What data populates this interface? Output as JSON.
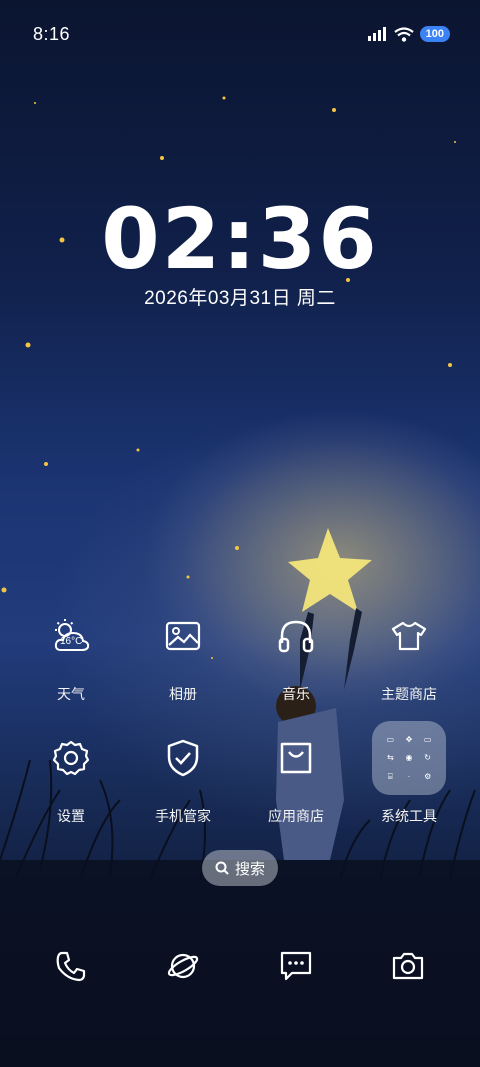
{
  "status_bar": {
    "time": "8:16",
    "battery": "100"
  },
  "clock": {
    "time": "02:36",
    "date": "2026年03月31日  周二"
  },
  "apps": [
    {
      "label": "天气",
      "icon": "weather-icon",
      "temp": "16°C"
    },
    {
      "label": "相册",
      "icon": "gallery-icon"
    },
    {
      "label": "音乐",
      "icon": "headphones-icon"
    },
    {
      "label": "主题商店",
      "icon": "tshirt-icon"
    },
    {
      "label": "设置",
      "icon": "gear-icon"
    },
    {
      "label": "手机管家",
      "icon": "shield-check-icon"
    },
    {
      "label": "应用商店",
      "icon": "shopping-bag-icon"
    },
    {
      "label": "系统工具",
      "icon": "folder-icon"
    }
  ],
  "search": {
    "label": "搜索"
  },
  "dock": [
    {
      "icon": "phone-icon"
    },
    {
      "icon": "browser-planet-icon"
    },
    {
      "icon": "message-icon"
    },
    {
      "icon": "camera-icon"
    }
  ]
}
